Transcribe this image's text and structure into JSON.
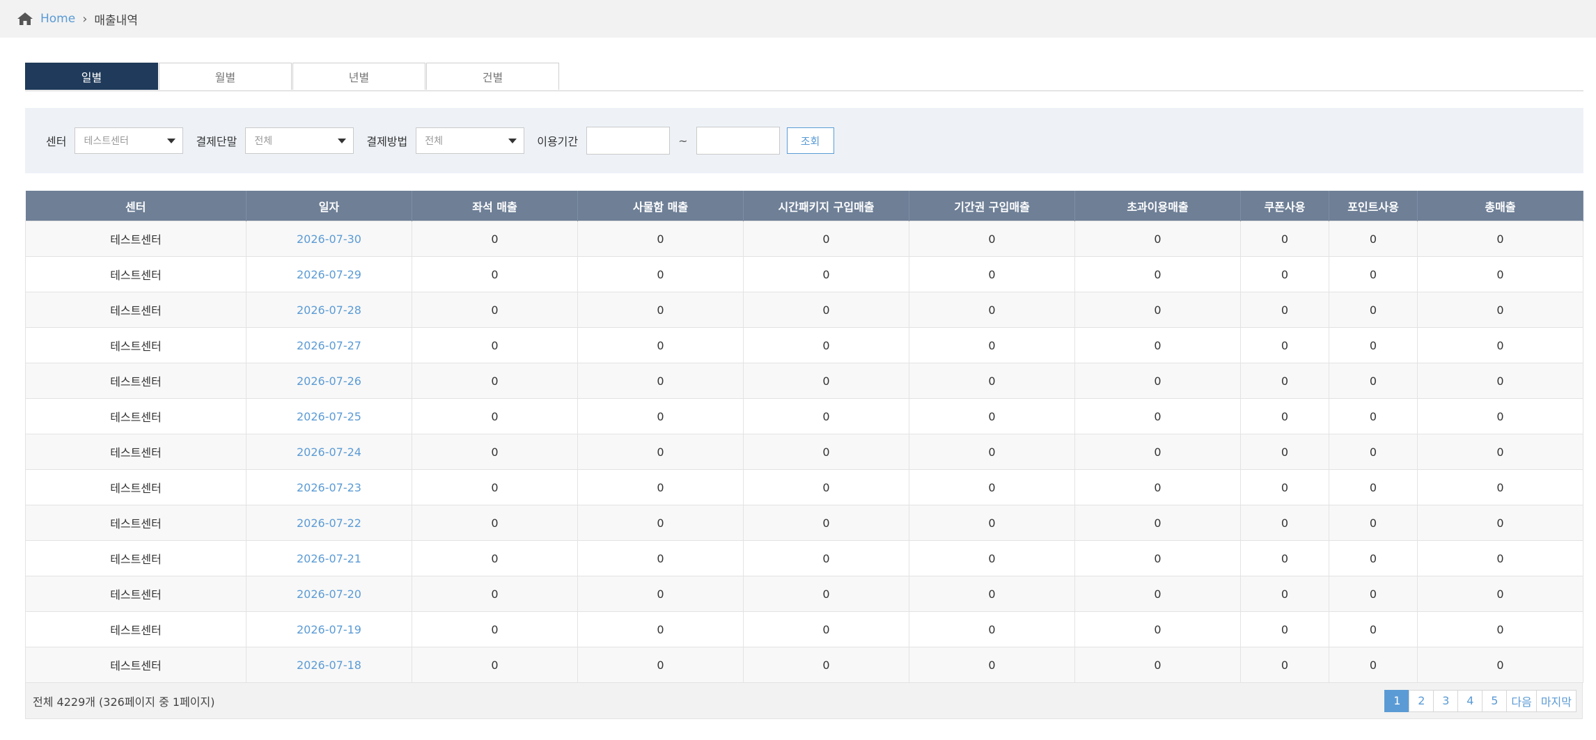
{
  "breadcrumb": {
    "home": "Home",
    "separator": "›",
    "current": "매출내역"
  },
  "tabs": [
    {
      "label": "일별"
    },
    {
      "label": "월별"
    },
    {
      "label": "년별"
    },
    {
      "label": "건별"
    }
  ],
  "filters": {
    "center_label": "센터",
    "center_value": "테스트센터",
    "terminal_label": "결제단말",
    "terminal_value": "전체",
    "method_label": "결제방법",
    "method_value": "전체",
    "period_label": "이용기간",
    "period_tilde": "~",
    "search_button": "조회"
  },
  "table": {
    "headers": [
      "센터",
      "일자",
      "좌석 매출",
      "사물함 매출",
      "시간패키지 구입매출",
      "기간권 구입매출",
      "초과이용매출",
      "쿠폰사용",
      "포인트사용",
      "총매출"
    ],
    "rows": [
      [
        "테스트센터",
        "2026-07-30",
        "0",
        "0",
        "0",
        "0",
        "0",
        "0",
        "0",
        "0"
      ],
      [
        "테스트센터",
        "2026-07-29",
        "0",
        "0",
        "0",
        "0",
        "0",
        "0",
        "0",
        "0"
      ],
      [
        "테스트센터",
        "2026-07-28",
        "0",
        "0",
        "0",
        "0",
        "0",
        "0",
        "0",
        "0"
      ],
      [
        "테스트센터",
        "2026-07-27",
        "0",
        "0",
        "0",
        "0",
        "0",
        "0",
        "0",
        "0"
      ],
      [
        "테스트센터",
        "2026-07-26",
        "0",
        "0",
        "0",
        "0",
        "0",
        "0",
        "0",
        "0"
      ],
      [
        "테스트센터",
        "2026-07-25",
        "0",
        "0",
        "0",
        "0",
        "0",
        "0",
        "0",
        "0"
      ],
      [
        "테스트센터",
        "2026-07-24",
        "0",
        "0",
        "0",
        "0",
        "0",
        "0",
        "0",
        "0"
      ],
      [
        "테스트센터",
        "2026-07-23",
        "0",
        "0",
        "0",
        "0",
        "0",
        "0",
        "0",
        "0"
      ],
      [
        "테스트센터",
        "2026-07-22",
        "0",
        "0",
        "0",
        "0",
        "0",
        "0",
        "0",
        "0"
      ],
      [
        "테스트센터",
        "2026-07-21",
        "0",
        "0",
        "0",
        "0",
        "0",
        "0",
        "0",
        "0"
      ],
      [
        "테스트센터",
        "2026-07-20",
        "0",
        "0",
        "0",
        "0",
        "0",
        "0",
        "0",
        "0"
      ],
      [
        "테스트센터",
        "2026-07-19",
        "0",
        "0",
        "0",
        "0",
        "0",
        "0",
        "0",
        "0"
      ],
      [
        "테스트센터",
        "2026-07-18",
        "0",
        "0",
        "0",
        "0",
        "0",
        "0",
        "0",
        "0"
      ]
    ]
  },
  "footer": {
    "summary": "전체 4229개 (326페이지 중 1페이지)"
  },
  "pagination": {
    "pages": [
      "1",
      "2",
      "3",
      "4",
      "5"
    ],
    "next": "다음",
    "last": "마지막",
    "active": "1"
  },
  "colors": {
    "tab_active": "#1f3a5a",
    "header_bg": "#6e7f96",
    "link": "#5b9bd5"
  }
}
